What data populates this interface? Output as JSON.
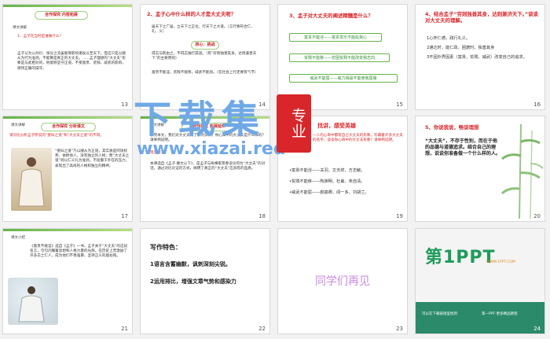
{
  "watermark": {
    "title": "下载集",
    "url": "www.xiazai.red",
    "stamp": "专业"
  },
  "slides": {
    "s13": {
      "num": "13",
      "header": "合作探究 内容拓展",
      "tag": "课文讲解",
      "q1": "1、孟子在当时是谁做什么？",
      "body": "孟子认为公孙衍、张仪之流虽能够影响诸侯以至天下，但这只是以顺从为行为准则，不能算是真正的大丈夫。……孟子理想的“大丈夫”形象是与此相对的，他能够坚守正道，不受富贵、贫贱、威武的影响，保持正确的操守。"
    },
    "s14": {
      "num": "14",
      "title": "2、孟子心中什么样的人才是大丈夫呢？",
      "p1": "居天下之广居，立天下之正位，行天下之大道。（言行要符合仁、礼、义）",
      "pill": "核心：挑战",
      "p2": "得志与民由之，不得志独行其道。（有“穷则独善其身，达则兼善天下”的主要原则）",
      "p3": "富贵不能淫，贫贱不能移，威武不能屈。（在社会上行走要有气节）"
    },
    "s15": {
      "num": "15",
      "title": "3、孟子对大丈夫的阐述精髓是什么？",
      "b1": "富贵不能淫——富贵享乐不能乱我心",
      "b2": "贫贱不能移——穷困贫贱不能改变我志向",
      "b3": "威武不能屈——威力相逼不能使我屈服"
    },
    "s16": {
      "num": "16",
      "title": "4、结合孟子“穷则独善其身，达则兼济天下。”谈谈对大丈夫的理解。",
      "l1": "1心怀仁德，践行礼义。",
      "l2": "2通达时，能仁政，困窘时，独善其身",
      "l3": "3不因外界因素（富贵、贫贱、威武）改变自己的追求。"
    },
    "s17": {
      "num": "17",
      "header": "合作探究 分析课文",
      "tag": "课文讲解",
      "lead": "请对比分析孟子所说的“妾妇之道”和“大丈夫之道”的不同。",
      "body": "“妾妇之道”乃以顺从为正道，其实质是阿谀权势、依附他人，没有独立的人格；而“大丈夫之道”则以仁义礼为准则，不屈服于外在的压力，表现出了高尚的人格和独立的精神。"
    },
    "s18": {
      "num": "18",
      "header": "合作探究 拓展延伸",
      "tag": "课文讲解",
      "lead": "学完本文，我们对大丈夫有了新的认识，你心目中的大丈夫是什么样的？请举例说明。",
      "link": "现实意义。",
      "body": "本课选自《孟子·滕文公下》，是孟子与纵横家景春谈论何为“大丈夫”的对话，通过对比论证的方式，阐明了真正的“大丈夫”应具有的品质。"
    },
    "s19": {
      "num": "19",
      "title": "找讲，感受英雄",
      "lead": "一人的心目中都有自己大丈夫的形象，珍藏着许多大丈夫的名字，谈谈你心目中的大丈夫形象？请举例说明。",
      "i1": "•富贵不能淫——关羽、文天祥、方志敏。",
      "i2": "•贫贱不能移——陶渊明、杜甫、朱自清。",
      "i3": "•威武不能屈——颜真卿、闻一多、刘胡兰。"
    },
    "s20": {
      "num": "20",
      "title": "5、你说我说，畅谈理想",
      "body": "“大丈夫”，不存于性别，而在于他的品德与道德追求。结合自己的理想，说说你准备做一个什么样的人。"
    },
    "s21": {
      "num": "21",
      "tag": "课文小结",
      "body": "《富贵不能淫》选自《孟子》一书，孟子关于“大丈夫”的这段名言，句句闪耀着思想和人格力量的光辉，在历史上曾激励了许多志士仁人，成为他们不畏强暴、坚持正义的座右铭。"
    },
    "s22": {
      "num": "22",
      "title": "写作特色：",
      "p1": "1语言含蓄幽默，讽刺深刻尖锐。",
      "p2": "2运用排比，增强文章气势和感染力"
    },
    "s23": {
      "num": "23",
      "text": "同学们再见"
    },
    "s24": {
      "num": "24",
      "logo": "第1PPT",
      "subtitle": "WWW.1PPT.COM",
      "f1": "可以在下载链接里找到",
      "f2": "第一PPT·更多精品教程"
    }
  }
}
